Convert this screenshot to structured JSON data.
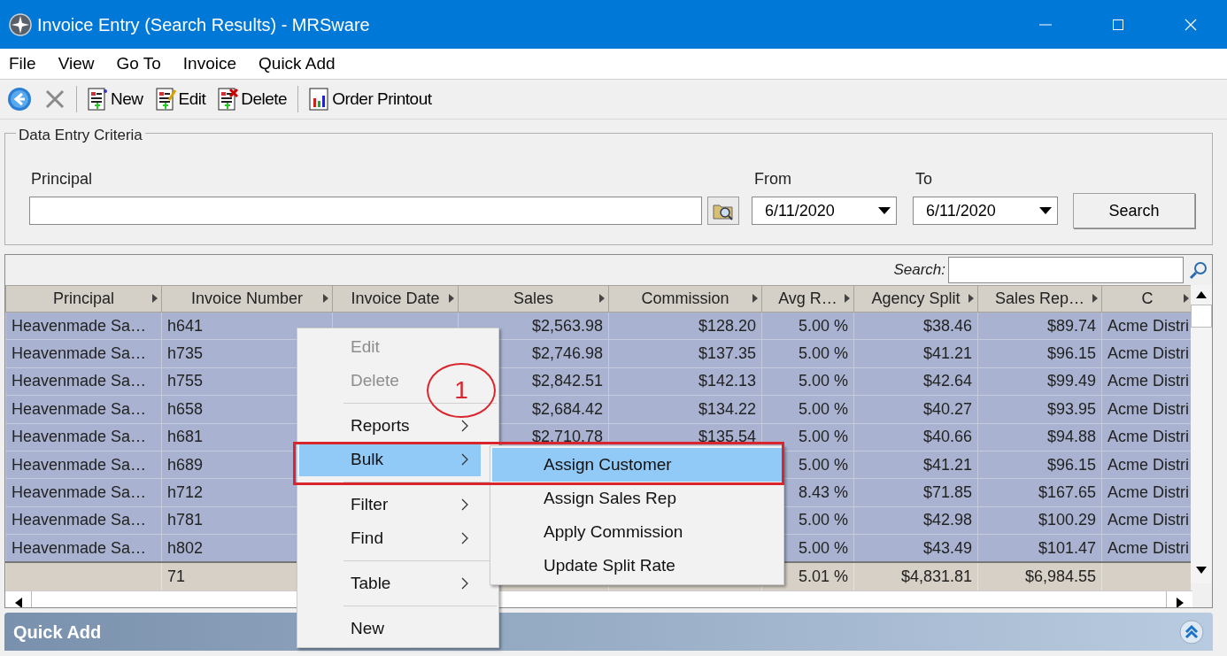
{
  "window": {
    "title": "Invoice Entry (Search Results) - MRSware"
  },
  "menu_bar": [
    "File",
    "View",
    "Go To",
    "Invoice",
    "Quick Add"
  ],
  "toolbar": [
    {
      "kind": "back"
    },
    {
      "kind": "cancel"
    },
    {
      "kind": "separator"
    },
    {
      "kind": "new",
      "label": "New"
    },
    {
      "kind": "edit",
      "label": "Edit"
    },
    {
      "kind": "delete",
      "label": "Delete"
    },
    {
      "kind": "separator"
    },
    {
      "kind": "report",
      "label": "Order Printout"
    }
  ],
  "criteria": {
    "title": "Data Entry Criteria",
    "principal_label": "Principal",
    "from_label": "From",
    "from_value": "6/11/2020",
    "to_label": "To",
    "to_value": "6/11/2020",
    "search_button": "Search"
  },
  "grid": {
    "search_label": "Search:",
    "columns": [
      {
        "label": "Principal"
      },
      {
        "label": "Invoice Number"
      },
      {
        "label": "Invoice Date"
      },
      {
        "label": "Sales"
      },
      {
        "label": "Commission"
      },
      {
        "label": "Avg R…"
      },
      {
        "label": "Agency Split"
      },
      {
        "label": "Sales Rep…"
      },
      {
        "label": "C"
      }
    ],
    "rows": [
      {
        "selected": true,
        "principal": "Heavenmade Sa…",
        "invoice_number": "h641",
        "sales": "$2,563.98",
        "commission": "$128.20",
        "avg_rate": "5.00 %",
        "agency_split": "$38.46",
        "sales_rep": "$89.74",
        "column_9": "Acme Distri"
      },
      {
        "selected": true,
        "principal": "Heavenmade Sa…",
        "invoice_number": "h735",
        "sales": "$2,746.98",
        "commission": "$137.35",
        "avg_rate": "5.00 %",
        "agency_split": "$41.21",
        "sales_rep": "$96.15",
        "column_9": "Acme Distri"
      },
      {
        "selected": true,
        "principal": "Heavenmade Sa…",
        "invoice_number": "h755",
        "sales": "$2,842.51",
        "commission": "$142.13",
        "avg_rate": "5.00 %",
        "agency_split": "$42.64",
        "sales_rep": "$99.49",
        "column_9": "Acme Distri"
      },
      {
        "selected": true,
        "principal": "Heavenmade Sa…",
        "invoice_number": "h658",
        "sales": "$2,684.42",
        "commission": "$134.22",
        "avg_rate": "5.00 %",
        "agency_split": "$40.27",
        "sales_rep": "$93.95",
        "column_9": "Acme Distri"
      },
      {
        "selected": true,
        "principal": "Heavenmade Sa…",
        "invoice_number": "h681",
        "sales": "$2,710.78",
        "commission": "$135.54",
        "avg_rate": "5.00 %",
        "agency_split": "$40.66",
        "sales_rep": "$94.88",
        "column_9": "Acme Distri"
      },
      {
        "selected": true,
        "principal": "Heavenmade Sa…",
        "invoice_number": "h689",
        "avg_rate": "5.00 %",
        "agency_split": "$41.21",
        "sales_rep": "$96.15",
        "column_9": "Acme Distri"
      },
      {
        "selected": true,
        "principal": "Heavenmade Sa…",
        "invoice_number": "h712",
        "avg_rate": "8.43 %",
        "agency_split": "$71.85",
        "sales_rep": "$167.65",
        "column_9": "Acme Distri"
      },
      {
        "selected": true,
        "principal": "Heavenmade Sa…",
        "invoice_number": "h781",
        "avg_rate": "5.00 %",
        "agency_split": "$42.98",
        "sales_rep": "$100.29",
        "column_9": "Acme Distri"
      },
      {
        "selected": true,
        "principal": "Heavenmade Sa…",
        "invoice_number": "h802",
        "avg_rate": "5.00 %",
        "agency_split": "$43.49",
        "sales_rep": "$101.47",
        "column_9": "Acme Distri"
      }
    ],
    "totals": {
      "invoice_number": "71",
      "avg_rate": "5.01 %",
      "agency_split": "$4,831.81",
      "sales_rep": "$6,984.55"
    }
  },
  "quick_add": {
    "title": "Quick Add"
  },
  "context_menu": {
    "items": [
      {
        "kind": "item",
        "label": "Edit",
        "disabled": true,
        "submenu": false,
        "selected": false
      },
      {
        "kind": "item",
        "label": "Delete",
        "disabled": true,
        "submenu": false,
        "selected": false
      },
      {
        "kind": "separator"
      },
      {
        "kind": "item",
        "label": "Reports",
        "disabled": false,
        "submenu": true,
        "selected": false
      },
      {
        "kind": "item",
        "label": "Bulk",
        "disabled": false,
        "submenu": true,
        "selected": true
      },
      {
        "kind": "separator"
      },
      {
        "kind": "item",
        "label": "Filter",
        "disabled": false,
        "submenu": true,
        "selected": false
      },
      {
        "kind": "item",
        "label": "Find",
        "disabled": false,
        "submenu": true,
        "selected": false
      },
      {
        "kind": "separator"
      },
      {
        "kind": "item",
        "label": "Table",
        "disabled": false,
        "submenu": true,
        "selected": false
      },
      {
        "kind": "separator"
      },
      {
        "kind": "item",
        "label": "New",
        "disabled": false,
        "submenu": false,
        "selected": false
      }
    ],
    "submenu": [
      {
        "label": "Assign Customer",
        "selected": true
      },
      {
        "label": "Assign Sales Rep",
        "selected": false
      },
      {
        "label": "Apply Commission",
        "selected": false
      },
      {
        "label": "Update Split Rate",
        "selected": false
      }
    ]
  },
  "annotation": {
    "label": "1"
  }
}
